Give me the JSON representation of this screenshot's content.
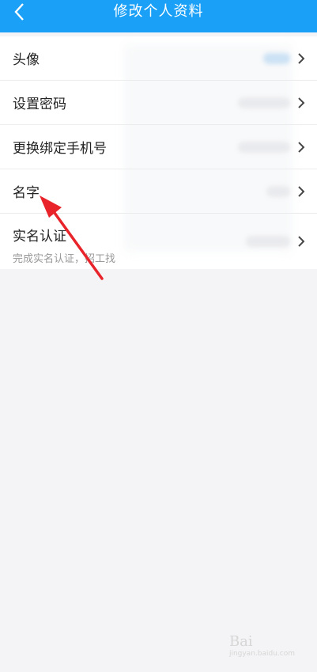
{
  "header": {
    "title": "修改个人资料",
    "back_icon": "chevron-left-icon"
  },
  "items": [
    {
      "label": "头像"
    },
    {
      "label": "设置密码"
    },
    {
      "label": "更换绑定手机号"
    },
    {
      "label": "名字"
    },
    {
      "label": "实名认证",
      "sublabel": "完成实名认证，招工找"
    }
  ],
  "watermark": {
    "brand": "Bai",
    "sub": "jingyan.baidu.com"
  },
  "colors": {
    "header_bg": "#1aa0f7",
    "background": "#f4f4f6",
    "arrow": "#e8232a"
  }
}
